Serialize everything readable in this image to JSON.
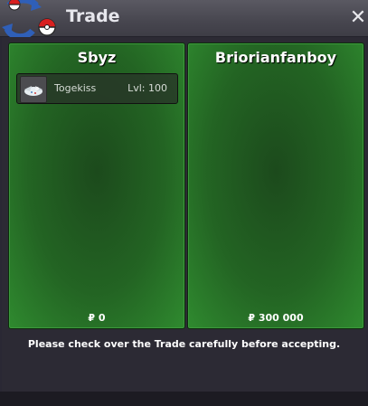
{
  "window": {
    "title": "Trade"
  },
  "left_panel": {
    "player": "Sbyz",
    "items": [
      {
        "name": "Togekiss",
        "level": "Lvl: 100",
        "icon": "togekiss-sprite"
      }
    ],
    "money": "₽ 0"
  },
  "right_panel": {
    "player": "Briorianfanboy",
    "items": [],
    "money": "₽ 300 000"
  },
  "notice": "Please check over the Trade carefully before accepting.",
  "icons": {
    "close": "close-icon",
    "app": "pokeball-trade-icon"
  },
  "colors": {
    "panel_green": "#236423",
    "title_bg": "#47464f",
    "window_bg": "#2c2a34"
  }
}
